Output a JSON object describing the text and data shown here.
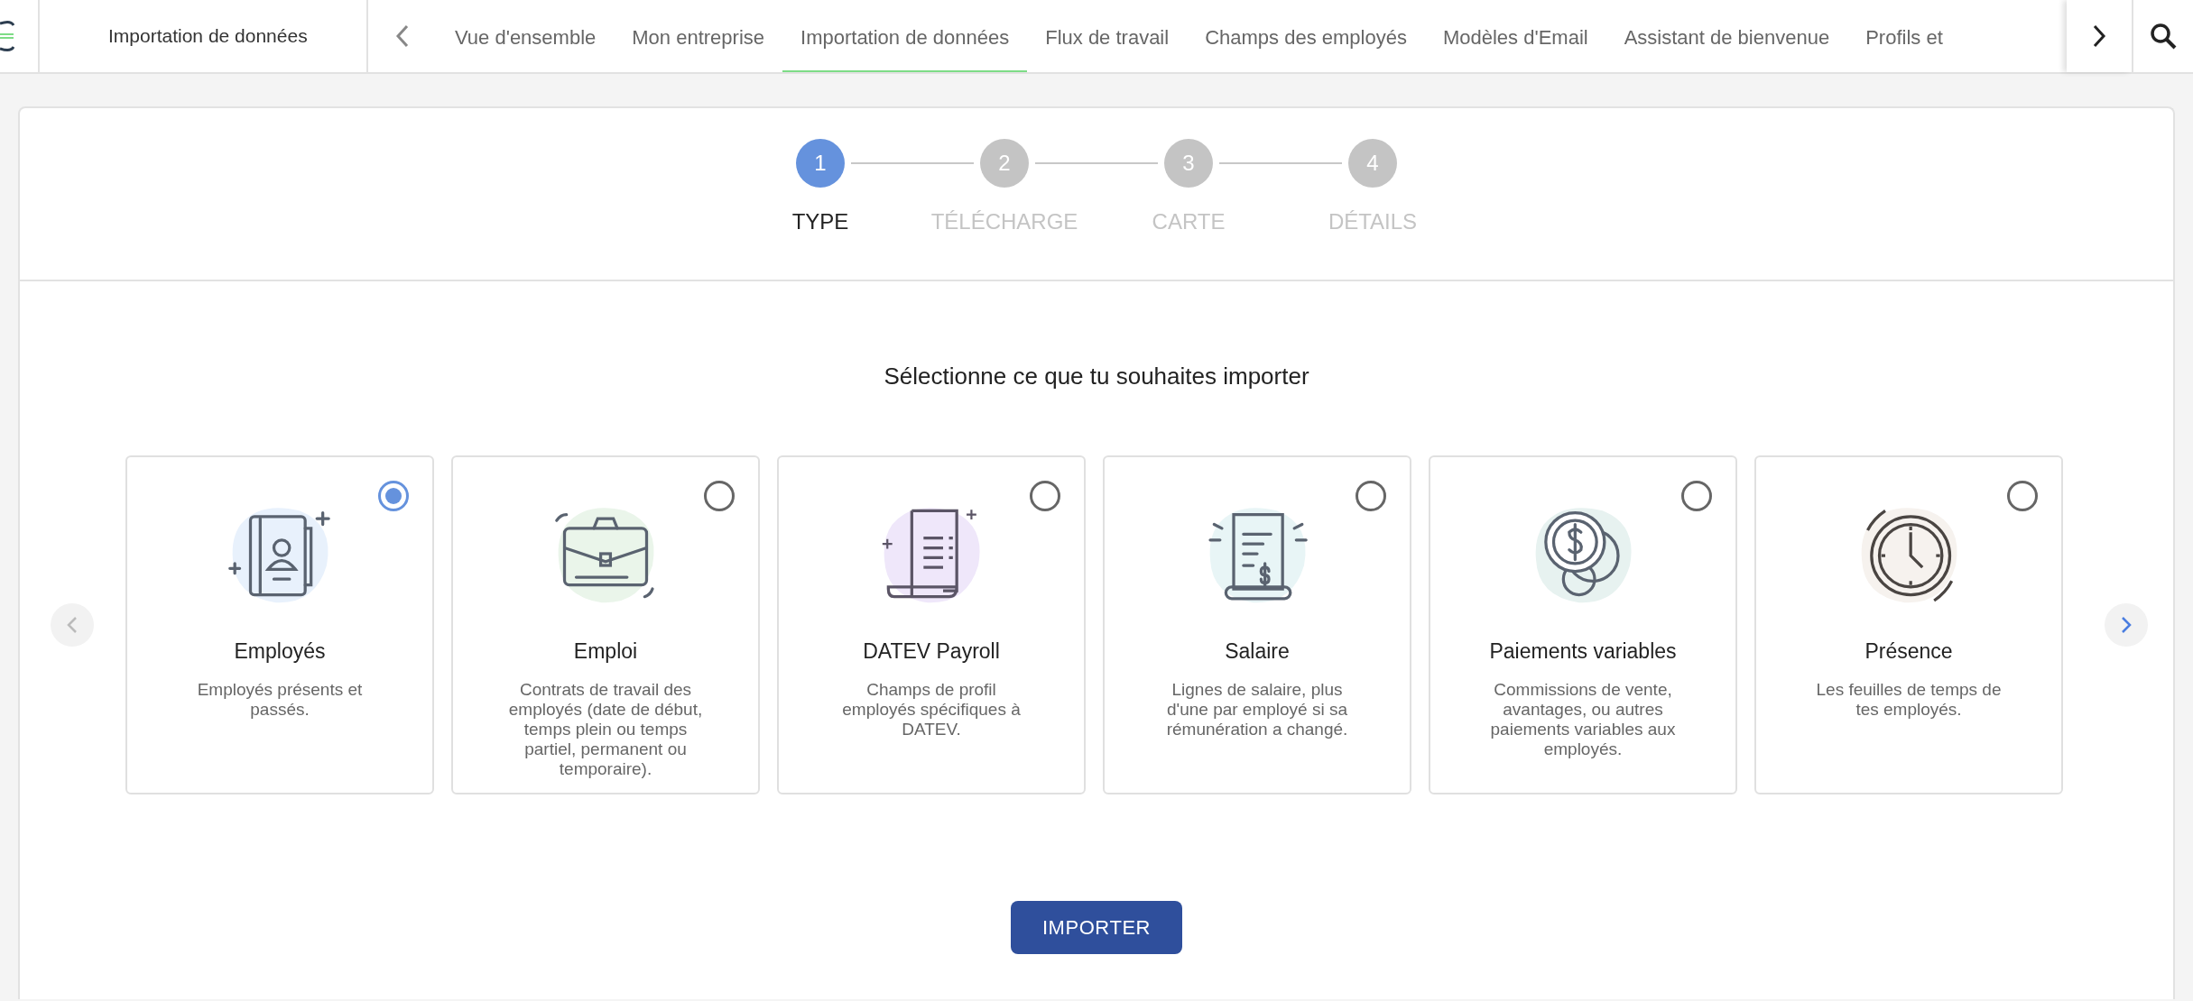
{
  "header": {
    "title": "Importation de données"
  },
  "tabs": [
    {
      "label": "Vue d'ensemble",
      "selected": false
    },
    {
      "label": "Mon entreprise",
      "selected": false
    },
    {
      "label": "Importation de données",
      "selected": true
    },
    {
      "label": "Flux de travail",
      "selected": false
    },
    {
      "label": "Champs des employés",
      "selected": false
    },
    {
      "label": "Modèles d'Email",
      "selected": false
    },
    {
      "label": "Assistant de bienvenue",
      "selected": false
    },
    {
      "label": "Profils et",
      "selected": false
    }
  ],
  "steps": [
    {
      "number": "1",
      "label": "TYPE",
      "selected": true
    },
    {
      "number": "2",
      "label": "TÉLÉCHARGE",
      "selected": false
    },
    {
      "number": "3",
      "label": "CARTE",
      "selected": false
    },
    {
      "number": "4",
      "label": "DÉTAILS",
      "selected": false
    }
  ],
  "heading": "Sélectionne ce que tu souhaites importer",
  "cards": [
    {
      "kind": "book",
      "title": "Employés",
      "description": "Employés présents et passés.",
      "selected": true
    },
    {
      "kind": "briefcase",
      "title": "Emploi",
      "description": "Contrats de travail des employés (date de début, temps plein ou temps partiel, permanent ou temporaire).",
      "selected": false
    },
    {
      "kind": "receipt",
      "title": "DATEV Payroll",
      "description": "Champs de profil employés spécifiques à DATEV.",
      "selected": false
    },
    {
      "kind": "bill",
      "title": "Salaire",
      "description": "Lignes de salaire, plus d'une par employé si sa rémunération a changé.",
      "selected": false
    },
    {
      "kind": "coins",
      "title": "Paiements variables",
      "description": "Commissions de vente, avantages, ou autres paiements variables aux employés.",
      "selected": false
    },
    {
      "kind": "clock",
      "title": "Présence",
      "description": "Les feuilles de temps de tes employés.",
      "selected": false
    }
  ],
  "button": "IMPORTER"
}
